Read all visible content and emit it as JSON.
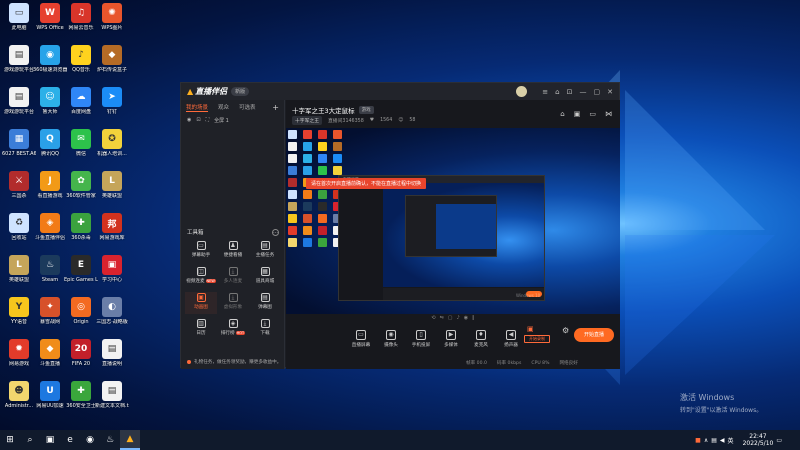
{
  "desktop": {
    "icons": [
      {
        "label": "此电脑",
        "glyph": "▭",
        "color": "#cfe3ff"
      },
      {
        "label": "WPS Office",
        "glyph": "W",
        "color": "#e6402f"
      },
      {
        "label": "网易云音乐",
        "glyph": "♫",
        "color": "#d8352a"
      },
      {
        "label": "WPS图片",
        "glyph": "✺",
        "color": "#e8552c"
      },
      {
        "label": "游戏游玩平台",
        "glyph": "▤",
        "color": "#f2f2f2"
      },
      {
        "label": "360极速浏览器",
        "glyph": "◉",
        "color": "#27a3e9"
      },
      {
        "label": "QQ音乐",
        "glyph": "♪",
        "color": "#ffd21e"
      },
      {
        "label": "炉石传说盒子",
        "glyph": "◆",
        "color": "#b56b26"
      },
      {
        "label": "游戏游玩平台",
        "glyph": "▤",
        "color": "#f2f2f2"
      },
      {
        "label": "鲁大师",
        "glyph": "☺",
        "color": "#2cb0e8"
      },
      {
        "label": "百度网盘",
        "glyph": "☁",
        "color": "#2f86f6"
      },
      {
        "label": "钉钉",
        "glyph": "➤",
        "color": "#1b8cf7"
      },
      {
        "label": "6027 BEST.A6 系...",
        "glyph": "▦",
        "color": "#3b7dd8"
      },
      {
        "label": "腾讯QQ",
        "glyph": "Q",
        "color": "#2aa0e8"
      },
      {
        "label": "微信",
        "glyph": "✉",
        "color": "#2dc24b"
      },
      {
        "label": "机器人培训...",
        "glyph": "✪",
        "color": "#f2d23b"
      },
      {
        "label": "三国杀",
        "glyph": "⚔",
        "color": "#b22c2c"
      },
      {
        "label": "看直播游戏",
        "glyph": "J",
        "color": "#f29a17"
      },
      {
        "label": "360软件管家",
        "glyph": "✿",
        "color": "#45b54c"
      },
      {
        "label": "英雄联盟",
        "glyph": "L",
        "color": "#c5a55a"
      },
      {
        "label": "回收站",
        "glyph": "♻",
        "color": "#cfe3ff"
      },
      {
        "label": "斗鱼直播伴侣",
        "glyph": "◈",
        "color": "#f27b17"
      },
      {
        "label": "360杀毒",
        "glyph": "✚",
        "color": "#3ba23e"
      },
      {
        "label": "网易游戏库",
        "glyph": "邦",
        "color": "#d2321e"
      },
      {
        "label": "英雄联盟",
        "glyph": "L",
        "color": "#c5a55a"
      },
      {
        "label": "Steam",
        "glyph": "♨",
        "color": "#1b3a5c"
      },
      {
        "label": "Epic Games Launcher",
        "glyph": "E",
        "color": "#2a2a2a"
      },
      {
        "label": "学习中心",
        "glyph": "▣",
        "color": "#d9232e"
      },
      {
        "label": "YY语音",
        "glyph": "Y",
        "color": "#f7c61d"
      },
      {
        "label": "暴雪战网",
        "glyph": "✦",
        "color": "#d7512a"
      },
      {
        "label": "Origin",
        "glyph": "◎",
        "color": "#f36a21"
      },
      {
        "label": "三国志·战略版",
        "glyph": "◐",
        "color": "#6a7ea8"
      },
      {
        "label": "网易游戏",
        "glyph": "✹",
        "color": "#e23b2a"
      },
      {
        "label": "斗鱼直播",
        "glyph": "◆",
        "color": "#f08c1a"
      },
      {
        "label": "FIFA 20",
        "glyph": "20",
        "color": "#c2202a"
      },
      {
        "label": "直播说明",
        "glyph": "▤",
        "color": "#f2f2f2"
      },
      {
        "label": "Administr...",
        "glyph": "☻",
        "color": "#f2d66e"
      },
      {
        "label": "网易UU加速",
        "glyph": "U",
        "color": "#1d78e0"
      },
      {
        "label": "360安全卫士",
        "glyph": "✚",
        "color": "#3aa63c"
      },
      {
        "label": "新建文本文档.txt",
        "glyph": "▤",
        "color": "#f2f2f2"
      }
    ],
    "watermark": {
      "title": "激活 Windows",
      "subtitle": "转到\"设置\"以激活 Windows。"
    }
  },
  "taskbar": {
    "items": [
      {
        "icon": "windows-start-icon",
        "glyph": "⊞"
      },
      {
        "icon": "search-icon",
        "glyph": "⌕"
      },
      {
        "icon": "task-view-icon",
        "glyph": "▣"
      },
      {
        "icon": "edge-icon",
        "glyph": "e"
      },
      {
        "icon": "chrome-icon",
        "glyph": "◉"
      },
      {
        "icon": "steam-icon",
        "glyph": "♨"
      },
      {
        "icon": "live-companion-icon",
        "glyph": "▲"
      }
    ],
    "clock_time": "22:47",
    "clock_date": "2022/5/10",
    "tray_text": "英"
  },
  "app": {
    "logo": "直播伴侣",
    "version": "新版",
    "window_controls": [
      "≡",
      "⌂",
      "⊡",
      "—",
      "▢",
      "✕"
    ],
    "sidebar": {
      "tabs": [
        "我的场景",
        "观众",
        "可选表"
      ],
      "scene_label": "全屏 1",
      "tools_header": "工具箱",
      "tools": [
        {
          "label": "弹幕助手",
          "glyph": "▭"
        },
        {
          "label": "便捷看播",
          "glyph": "♟"
        },
        {
          "label": "主播任务",
          "glyph": "▤"
        },
        {
          "label": "视频连麦",
          "glyph": "◫",
          "tag": "NEW"
        },
        {
          "label": "多人连麦",
          "glyph": "⤓"
        },
        {
          "label": "道具商城",
          "glyph": "▦"
        },
        {
          "label": "动画图",
          "glyph": "▣"
        },
        {
          "label": "虚拟形象",
          "glyph": "⤓"
        },
        {
          "label": "弹幕图",
          "glyph": "▤"
        },
        {
          "label": "日历",
          "glyph": "▥"
        },
        {
          "label": "排行榜",
          "glyph": "◈",
          "tag": "HOT"
        },
        {
          "label": "下载",
          "glyph": "⤓"
        }
      ],
      "tip_text": "礼物任务，做任务领奖励，赚更多收益中。",
      "tip_link": "查看领取"
    },
    "room": {
      "title": "十字军之王3大定鼠标",
      "tag": "游戏",
      "chip": "十字军之王",
      "id": "直播间3146358",
      "likes": "1564",
      "viewers": "58"
    },
    "preview": {
      "banner": "请在首次开启直播前确认，不能在直播过程中切换",
      "nested_logo": "直播伴侣",
      "corner_mark": "Windows 10"
    },
    "bottom_bar": [
      {
        "label": "直播屏幕",
        "glyph": "▭"
      },
      {
        "label": "摄像头",
        "glyph": "◉"
      },
      {
        "label": "手机投屏",
        "glyph": "▯"
      },
      {
        "label": "多媒体",
        "glyph": "▶"
      },
      {
        "label": "麦克风",
        "glyph": "♦"
      },
      {
        "label": "扬声器",
        "glyph": "◀"
      }
    ],
    "record_label": "开始录制",
    "start_live": "开始直播",
    "status": [
      "帧率 00.0",
      "码率 0kbps",
      "CPU 8%",
      "网络良好"
    ]
  }
}
